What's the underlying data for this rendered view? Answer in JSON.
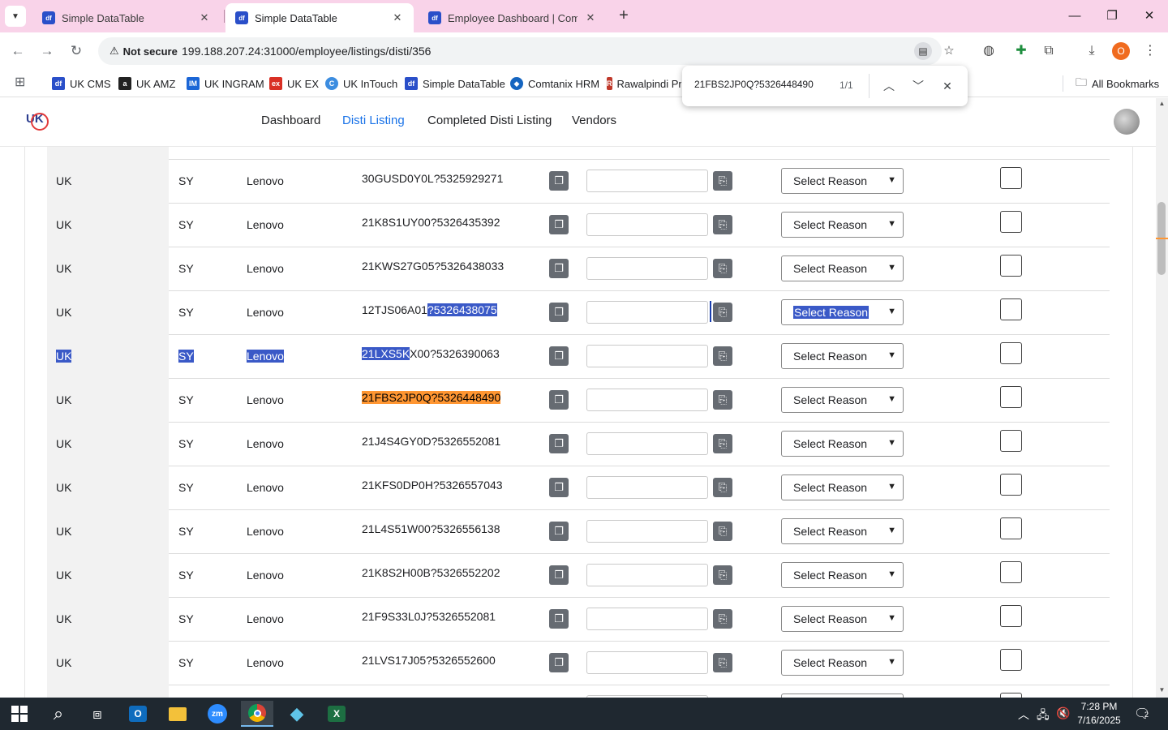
{
  "browser": {
    "tabs": [
      {
        "favicon": "df",
        "title": "Simple DataTable",
        "active": false
      },
      {
        "favicon": "df",
        "title": "Simple DataTable",
        "active": true
      },
      {
        "favicon": "df",
        "title": "Employee Dashboard | Comtan",
        "active": false
      }
    ],
    "close_glyph": "✕",
    "new_tab_glyph": "+",
    "url_security": "Not secure",
    "url": "199.188.207.24:31000/employee/listings/disti/356",
    "profile_initial": "O",
    "bookmarks": [
      {
        "label": "UK CMS",
        "icon": "df",
        "color": "#2a4fc9"
      },
      {
        "label": "UK AMZ",
        "icon": "a",
        "color": "#222222"
      },
      {
        "label": "UK INGRAM",
        "icon": "IM",
        "color": "#1b66d6"
      },
      {
        "label": "UK EX",
        "icon": "ex",
        "color": "#d93025"
      },
      {
        "label": "UK InTouch",
        "icon": "C",
        "color": "#3c8de0"
      },
      {
        "label": "Simple DataTable",
        "icon": "df",
        "color": "#2a4fc9"
      },
      {
        "label": "Comtanix HRM",
        "icon": "◆",
        "color": "#1565c0"
      },
      {
        "label": "Rawalpindi Pr",
        "icon": "R",
        "color": "#c0392b"
      }
    ],
    "all_bookmarks": "All Bookmarks"
  },
  "find": {
    "query": "21FBS2JP0Q?5326448490",
    "count": "1/1"
  },
  "header": {
    "logo_text": "UK",
    "nav": [
      "Dashboard",
      "Disti Listing",
      "Completed Disti Listing",
      "Vendors"
    ],
    "active_nav": "Disti Listing"
  },
  "table": {
    "select_placeholder": "Select Reason",
    "rows": [
      {
        "country": "UK",
        "code": "SY",
        "brand": "Lenovo",
        "sku": "30GUSD0Y0L?5325929271"
      },
      {
        "country": "UK",
        "code": "SY",
        "brand": "Lenovo",
        "sku": "21K8S1UY00?5326435392"
      },
      {
        "country": "UK",
        "code": "SY",
        "brand": "Lenovo",
        "sku": "21KWS27G05?5326438033"
      },
      {
        "country": "UK",
        "code": "SY",
        "brand": "Lenovo",
        "sku_a": "12TJS06A01",
        "sku_b": "?5326438075"
      },
      {
        "country": "UK",
        "code": "SY",
        "brand": "Lenovo",
        "sku_a": "21LXS5K",
        "sku_b": "X00?5326390063"
      },
      {
        "country": "UK",
        "code": "SY",
        "brand": "Lenovo",
        "sku": "21FBS2JP0Q?5326448490"
      },
      {
        "country": "UK",
        "code": "SY",
        "brand": "Lenovo",
        "sku": "21J4S4GY0D?5326552081"
      },
      {
        "country": "UK",
        "code": "SY",
        "brand": "Lenovo",
        "sku": "21KFS0DP0H?5326557043"
      },
      {
        "country": "UK",
        "code": "SY",
        "brand": "Lenovo",
        "sku": "21L4S51W00?5326556138"
      },
      {
        "country": "UK",
        "code": "SY",
        "brand": "Lenovo",
        "sku": "21K8S2H00B?5326552202"
      },
      {
        "country": "UK",
        "code": "SY",
        "brand": "Lenovo",
        "sku": "21F9S33L0J?5326552081"
      },
      {
        "country": "UK",
        "code": "SY",
        "brand": "Lenovo",
        "sku": "21LVS17J05?5326552600"
      }
    ]
  },
  "taskbar": {
    "time": "7:28 PM",
    "date": "7/16/2025",
    "notifications": "2"
  },
  "colors": {
    "tabbar_bg": "#f9d3e9",
    "accent": "#1a73e8",
    "selection": "#3a59c7",
    "find_highlight": "#ff9632",
    "copy_button": "#666b72"
  }
}
